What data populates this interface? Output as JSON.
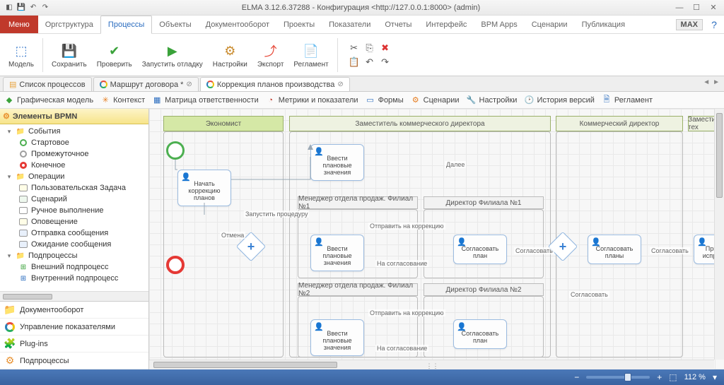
{
  "title": "ELMA 3.12.6.37288 - Конфигурация <http://127.0.0.1:8000> (admin)",
  "menubtn": "Меню",
  "menutabs": [
    "Оргструктура",
    "Процессы",
    "Объекты",
    "Документооборот",
    "Проекты",
    "Показатели",
    "Отчеты",
    "Интерфейс",
    "BPM Apps",
    "Сценарии",
    "Публикация"
  ],
  "menutab_active": 1,
  "max_label": "MAX",
  "ribbon": {
    "model": "Модель",
    "save": "Сохранить",
    "check": "Проверить",
    "debug": "Запустить\nотладку",
    "settings": "Настройки",
    "export": "Экспорт",
    "reglament": "Регламент"
  },
  "doctabs": [
    {
      "label": "Список процессов"
    },
    {
      "label": "Маршрут договора *"
    },
    {
      "label": "Коррекция планов производства"
    }
  ],
  "doctab_active": 2,
  "subbar": [
    "Графическая модель",
    "Контекст",
    "Матрица ответственности",
    "Метрики и показатели",
    "Формы",
    "Сценарии",
    "Настройки",
    "История версий",
    "Регламент"
  ],
  "bpmn_header": "Элементы BPMN",
  "tree": {
    "events": "События",
    "events_children": [
      "Стартовое",
      "Промежуточное",
      "Конечное"
    ],
    "ops": "Операции",
    "ops_children": [
      "Пользовательская Задача",
      "Сценарий",
      "Ручное выполнение",
      "Оповещение",
      "Отправка сообщения",
      "Ожидание сообщения"
    ],
    "subs": "Подпроцессы",
    "subs_children": [
      "Внешний подпроцесс",
      "Внутренний подпроцесс"
    ]
  },
  "accordion": [
    "Документооборот",
    "Управление показателями",
    "Plug-ins",
    "Подпроцессы"
  ],
  "lanes": {
    "economist": "Экономист",
    "zam_comm": "Заместитель коммерческого директора",
    "mgr1": "Менеджер отдела продаж. Филиал №1",
    "dir1": "Директор Филиала №1",
    "mgr2": "Менеджер отдела продаж. Филиал №2",
    "dir2": "Директор Филиала №2",
    "comm_dir": "Коммерческий директор",
    "zam_tech": "Заместитель тех"
  },
  "tasks": {
    "start_corr": "Начать коррекцию планов",
    "enter_plan": "Ввести плановые значения",
    "agree_plan": "Согласовать план",
    "agree_plans": "Согласовать планы",
    "accept_fix": "При испра"
  },
  "edge_labels": {
    "run": "Запустить процедуру",
    "next": "Далее",
    "cancel": "Отмена",
    "send_corr": "Отправить на коррекцию",
    "to_agree": "На согласование",
    "agree": "Согласовать"
  },
  "status": {
    "zoom": "112 %"
  }
}
